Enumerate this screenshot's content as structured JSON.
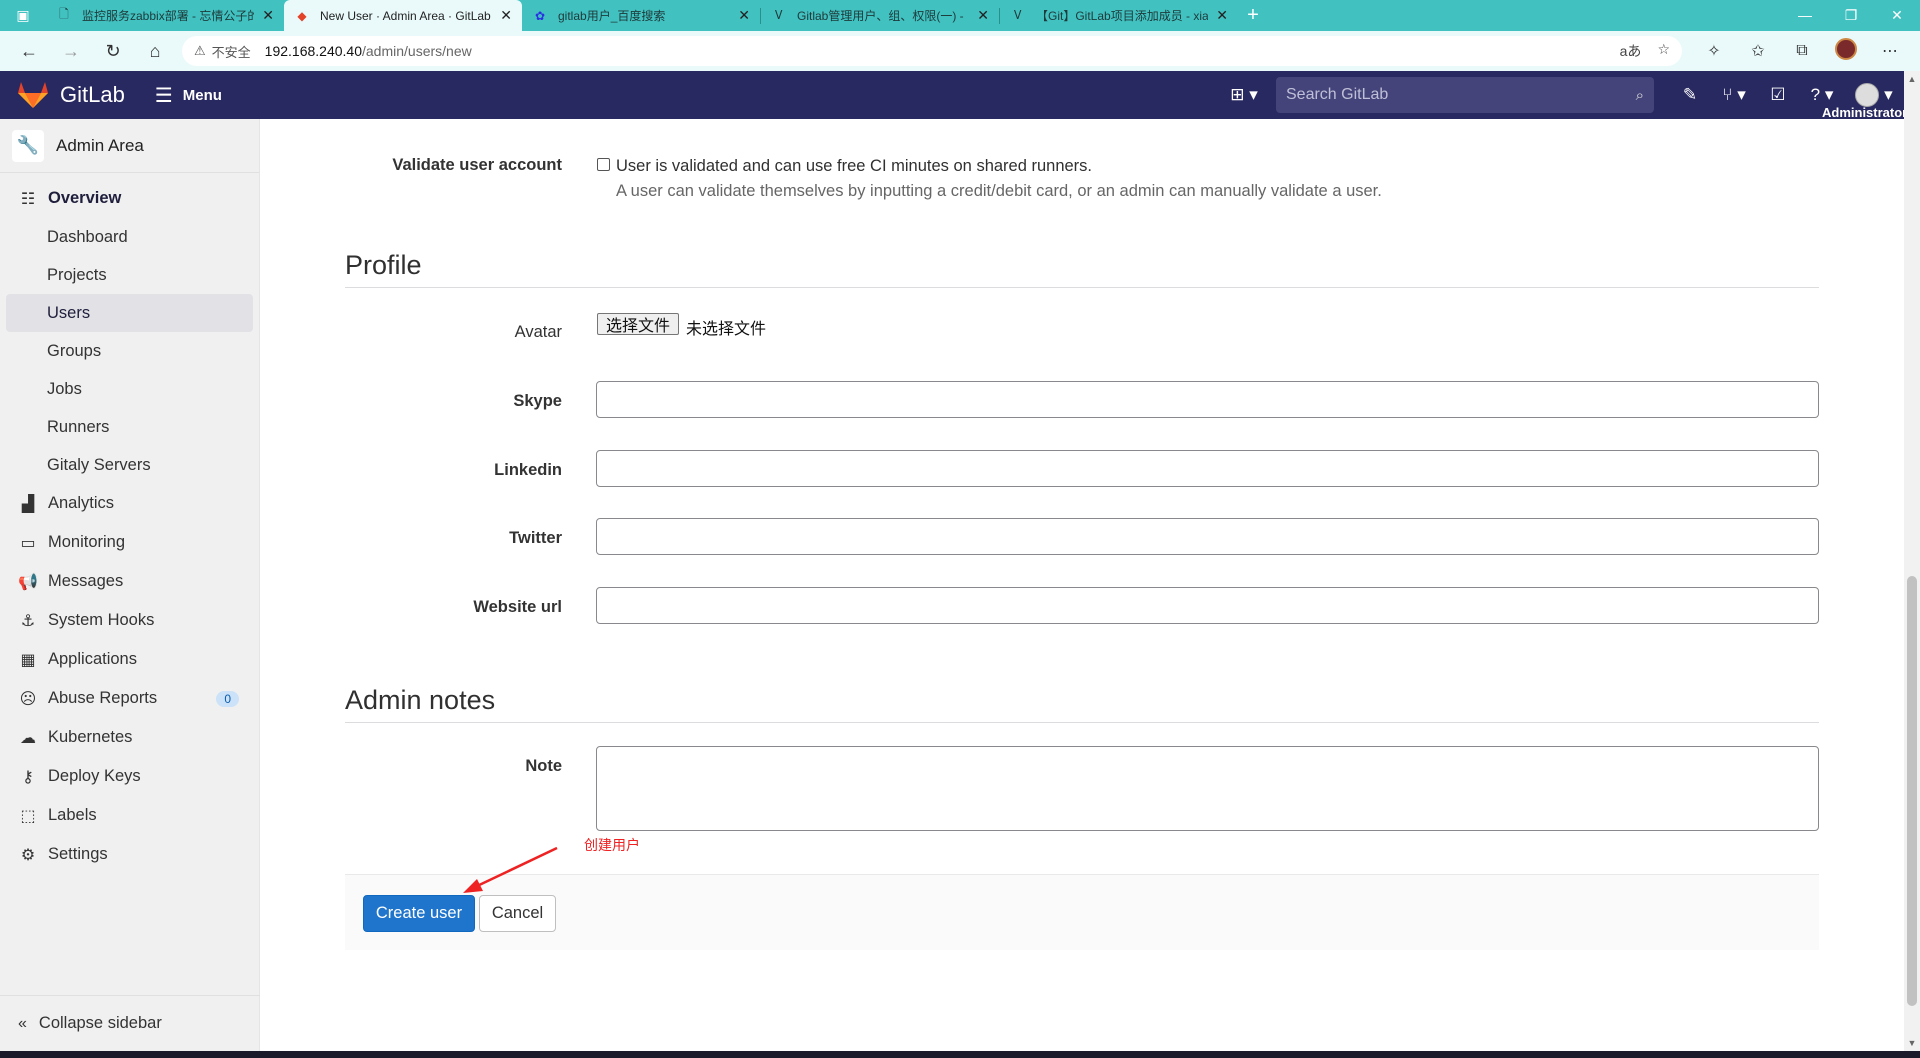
{
  "browser": {
    "tabs": [
      {
        "title": "监控服务zabbix部署 - 忘情公子的",
        "icon": "doc-icon",
        "active": false
      },
      {
        "title": "New User · Admin Area · GitLab",
        "icon": "gitlab-icon",
        "active": true
      },
      {
        "title": "gitlab用户_百度搜索",
        "icon": "baidu-icon",
        "active": false
      },
      {
        "title": "Gitlab管理用户、组、权限(一) -",
        "icon": "cnblogs-icon",
        "active": false
      },
      {
        "title": "【Git】GitLab项目添加成员 - xia",
        "icon": "cnblogs-icon",
        "active": false
      }
    ],
    "address": {
      "security_label": "不安全",
      "host": "192.168.240.40",
      "path": "/admin/users/new"
    }
  },
  "header": {
    "brand": "GitLab",
    "menu_label": "Menu",
    "search_placeholder": "Search GitLab",
    "user_label": "Administrator"
  },
  "sidebar": {
    "context_title": "Admin Area",
    "items": [
      {
        "label": "Overview",
        "icon": "overview-icon"
      },
      {
        "label": "Dashboard"
      },
      {
        "label": "Projects"
      },
      {
        "label": "Users"
      },
      {
        "label": "Groups"
      },
      {
        "label": "Jobs"
      },
      {
        "label": "Runners"
      },
      {
        "label": "Gitaly Servers"
      },
      {
        "label": "Analytics",
        "icon": "analytics-icon"
      },
      {
        "label": "Monitoring",
        "icon": "monitoring-icon"
      },
      {
        "label": "Messages",
        "icon": "messages-icon"
      },
      {
        "label": "System Hooks",
        "icon": "hooks-icon"
      },
      {
        "label": "Applications",
        "icon": "applications-icon"
      },
      {
        "label": "Abuse Reports",
        "icon": "abuse-icon",
        "badge": "0"
      },
      {
        "label": "Kubernetes",
        "icon": "kubernetes-icon"
      },
      {
        "label": "Deploy Keys",
        "icon": "key-icon"
      },
      {
        "label": "Labels",
        "icon": "label-icon"
      },
      {
        "label": "Settings",
        "icon": "settings-icon"
      }
    ],
    "collapse_label": "Collapse sidebar"
  },
  "form": {
    "validate": {
      "label": "Validate user account",
      "checkbox_label": "User is validated and can use free CI minutes on shared runners.",
      "help": "A user can validate themselves by inputting a credit/debit card, or an admin can manually validate a user."
    },
    "profile": {
      "title": "Profile",
      "avatar_label": "Avatar",
      "file_button": "选择文件",
      "file_status": "未选择文件",
      "skype_label": "Skype",
      "linkedin_label": "Linkedin",
      "twitter_label": "Twitter",
      "website_label": "Website url"
    },
    "admin_notes": {
      "title": "Admin notes",
      "note_label": "Note"
    },
    "annotation": "创建用户",
    "create_button": "Create user",
    "cancel_button": "Cancel"
  },
  "colors": {
    "header_bg": "#292961",
    "tabstrip_bg": "#42c1c1",
    "primary": "#1f75cb",
    "annotation": "#ee2222"
  }
}
